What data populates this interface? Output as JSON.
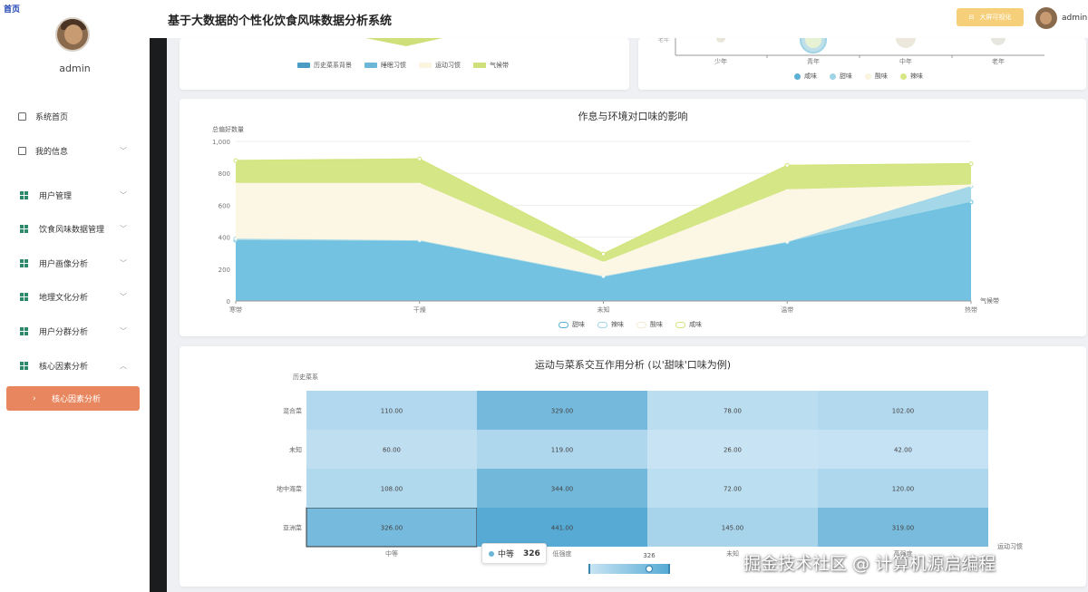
{
  "corner_mark": "首页",
  "app": {
    "title": "基于大数据的个性化饮食风味数据分析系统",
    "bigscreen_label": "大屏可视化",
    "header_user": "admin"
  },
  "sidebar": {
    "username": "admin",
    "items": [
      {
        "label": "系统首页",
        "icon": "home-icon"
      },
      {
        "label": "我的信息",
        "icon": "info-icon"
      },
      {
        "label": "用户管理",
        "icon": "grid-icon"
      },
      {
        "label": "饮食风味数据管理",
        "icon": "grid-icon"
      },
      {
        "label": "用户画像分析",
        "icon": "grid-icon"
      },
      {
        "label": "地理文化分析",
        "icon": "grid-icon"
      },
      {
        "label": "用户分群分析",
        "icon": "grid-icon"
      },
      {
        "label": "核心因素分析",
        "icon": "grid-icon"
      }
    ],
    "active_item": "核心因素分析"
  },
  "top_left_chart": {
    "legend": [
      {
        "name": "历史菜系背景",
        "color": "#4a9cc5"
      },
      {
        "name": "睡眠习惯",
        "color": "#6cb6d8"
      },
      {
        "name": "运动习惯",
        "color": "#fbf4de"
      },
      {
        "name": "气候带",
        "color": "#cfe07a"
      }
    ]
  },
  "top_right_chart": {
    "ylabel_fragment": "老年",
    "categories": [
      "少年",
      "青年",
      "中年",
      "老年"
    ],
    "legend": [
      {
        "name": "咸味",
        "color": "#5ab0d4"
      },
      {
        "name": "甜味",
        "color": "#9fd3e6"
      },
      {
        "name": "酸味",
        "color": "#fbf4de"
      },
      {
        "name": "辣味",
        "color": "#d6e686"
      }
    ]
  },
  "chart_data": [
    {
      "type": "area",
      "title": "作息与环境对口味的影响",
      "ylabel": "总偏好数量",
      "xlabel": "气候带",
      "categories": [
        "寒带",
        "干燥",
        "未知",
        "温带",
        "热带"
      ],
      "ylim": [
        0,
        1000
      ],
      "yticks": [
        "0",
        "200",
        "400",
        "600",
        "800",
        "1,000"
      ],
      "stacked": true,
      "series": [
        {
          "name": "甜味",
          "color": "#6bbfdf",
          "values": [
            380,
            375,
            150,
            370,
            620
          ]
        },
        {
          "name": "辣味",
          "color": "#9fd6e8",
          "values": [
            10,
            5,
            5,
            0,
            100
          ]
        },
        {
          "name": "酸味",
          "color": "#fcf6e3",
          "values": [
            350,
            360,
            90,
            330,
            10
          ]
        },
        {
          "name": "咸味",
          "color": "#d2e57f",
          "values": [
            140,
            150,
            50,
            150,
            130
          ]
        }
      ],
      "legend": [
        "甜味",
        "辣味",
        "酸味",
        "咸味"
      ]
    },
    {
      "type": "heatmap",
      "title": "运动与菜系交互作用分析 (以'甜味'口味为例)",
      "ylabel": "历史菜系",
      "xlabel": "运动习惯",
      "y_categories": [
        "亚洲菜",
        "地中海菜",
        "未知",
        "混合菜"
      ],
      "x_categories": [
        "中等",
        "低强度",
        "未知",
        "高强度"
      ],
      "values": [
        [
          326.0,
          441.0,
          145.0,
          319.0
        ],
        [
          108.0,
          344.0,
          72.0,
          120.0
        ],
        [
          60.0,
          119.0,
          26.0,
          42.0
        ],
        [
          110.0,
          329.0,
          78.0,
          102.0
        ]
      ],
      "visual_map_value": "326"
    }
  ],
  "tooltip": {
    "label": "中等",
    "value": "326"
  },
  "watermark": "掘金技术社区 @ 计算机源启编程"
}
